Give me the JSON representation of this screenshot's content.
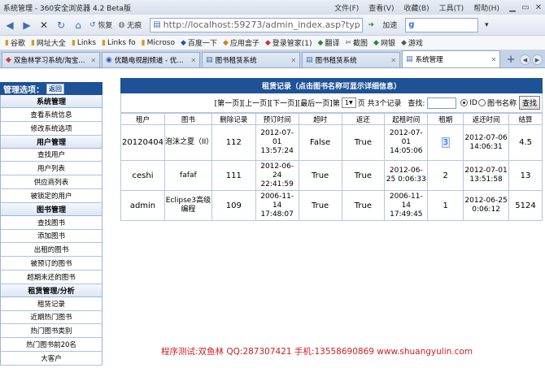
{
  "window": {
    "title": "系统管理 - 360安全浏览器 4.2 Beta版",
    "menu": [
      "文件(F)",
      "查看(V)",
      "收藏(B)",
      "工具(T)",
      "帮助(H)"
    ]
  },
  "nav": {
    "restore_label": "恢复",
    "nopic_label": "无痕",
    "address": "http://localhost:59273/admin_index.asp?typ",
    "speed_label": "加速"
  },
  "favorites": [
    "谷歌",
    "网址大全",
    "Links",
    "Links fo",
    "Microso",
    "百度一下",
    "应用盒子",
    "登录管家(1)",
    "翻译",
    "截图",
    "网银",
    "游戏"
  ],
  "tabs": [
    {
      "label": "双鱼林学习系统/淘宝..."
    },
    {
      "label": "优酷电视剧频道 - 优..."
    },
    {
      "label": "图书租赁系统"
    },
    {
      "label": "图书租赁系统"
    },
    {
      "label": "系统管理"
    }
  ],
  "sidebar": {
    "header": "管理选项：",
    "return_label": "返回",
    "groups": [
      {
        "title": "系统管理",
        "items": [
          "查看系统信息",
          "修改系统选项"
        ]
      },
      {
        "title": "用户管理",
        "items": [
          "查找用户",
          "用户列表",
          "供应商列表",
          "被锁定的用户"
        ]
      },
      {
        "title": "图书管理",
        "items": [
          "查找图书",
          "添加图书",
          "出租的图书",
          "被预订的图书",
          "超期未还的图书"
        ]
      },
      {
        "title": "租赁管理/分析",
        "items": [
          "租赁记录",
          "近期热门图书",
          "热门图书类别",
          "热门图书前20名",
          "大客户"
        ]
      }
    ]
  },
  "records": {
    "title": "租赁记录（点击图书名称可显示详细信息）",
    "pager": {
      "first": "[第一页]",
      "prev": "[上一页]",
      "next": "[下一页]",
      "last": "[最后一页]",
      "page_prefix": "第",
      "page_value": "1",
      "page_suffix": "页 共3个记录",
      "search_label": "查找:",
      "radio_id": "ID",
      "radio_book": "图书名称",
      "search_button": "查找"
    },
    "columns": [
      "租户",
      "图书",
      "删除记录",
      "预订时间",
      "超时",
      "返还",
      "起租时间",
      "租期",
      "返还时间",
      "结算"
    ],
    "rows": [
      [
        "20120404",
        "泡沫之夏（II）",
        "112",
        "2012-07-01 13:57:24",
        "False",
        "True",
        "2012-07-01 14:05:06",
        "3",
        "2012-07-06 14:06:31",
        "4.5"
      ],
      [
        "ceshi",
        "fafaf",
        "111",
        "2012-06-24 22:41:59",
        "True",
        "True",
        "2012-06-25 0:06:33",
        "2",
        "2012-07-01 13:51:58",
        "13"
      ],
      [
        "admin",
        "Eclipse3高级编程",
        "109",
        "2006-11-14 17:48:07",
        "True",
        "True",
        "2006-11-14 17:49:45",
        "1",
        "2012-06-25 0:06:12",
        "5124"
      ]
    ]
  },
  "footer": "程序测试:双鱼林 QQ:287307421 手机:13558690869 www.shuangyulin.com",
  "colors": {
    "header_blue": "#1e5296",
    "footer_red": "#cc1f1f"
  }
}
